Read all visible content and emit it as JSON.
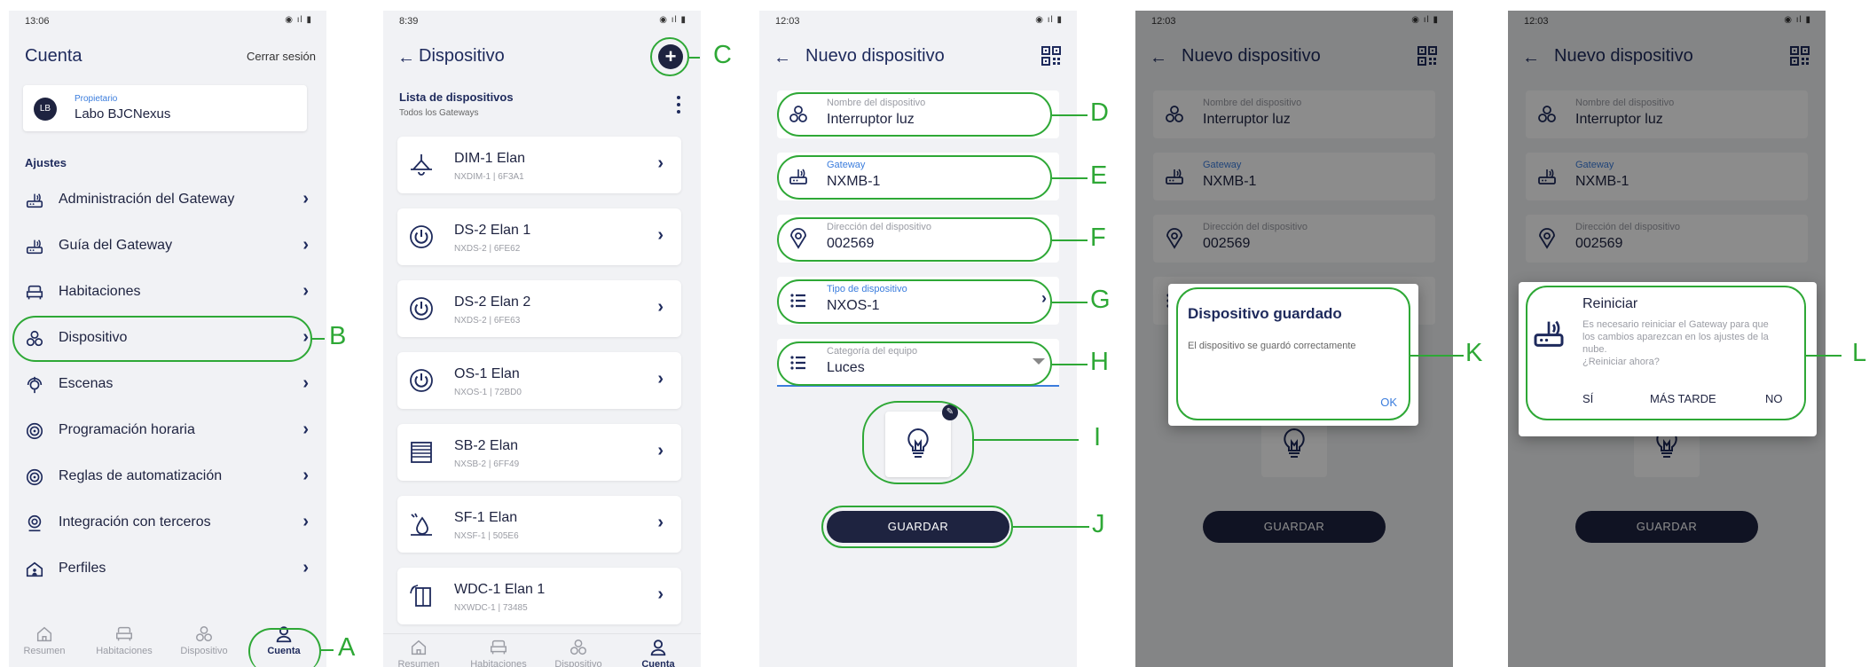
{
  "screen1": {
    "time": "13:06",
    "title": "Cuenta",
    "logout": "Cerrar sesión",
    "owner_initials": "LB",
    "owner_role": "Propietario",
    "owner_name": "Labo BJCNexus",
    "settings_label": "Ajustes",
    "menu": [
      {
        "label": "Administración del Gateway",
        "icon": "gateway-icon"
      },
      {
        "label": "Guía del Gateway",
        "icon": "gateway-icon"
      },
      {
        "label": "Habitaciones",
        "icon": "sofa-icon"
      },
      {
        "label": "Dispositivo",
        "icon": "device-icon"
      },
      {
        "label": "Escenas",
        "icon": "scene-icon"
      },
      {
        "label": "Programación horaria",
        "icon": "schedule-icon"
      },
      {
        "label": "Reglas de automatización",
        "icon": "automation-icon"
      },
      {
        "label": "Integración con terceros",
        "icon": "integration-icon"
      },
      {
        "label": "Perfiles",
        "icon": "house-icon"
      }
    ]
  },
  "screen2": {
    "time": "8:39",
    "title": "Dispositivo",
    "list_title": "Lista de dispositivos",
    "list_sub": "Todos los Gateways",
    "devices": [
      {
        "name": "DIM-1 Elan",
        "sub": "NXDIM-1  |  6F3A1",
        "icon": "lamp-icon"
      },
      {
        "name": "DS-2 Elan 1",
        "sub": "NXDS-2  |  6FE62",
        "icon": "power-icon"
      },
      {
        "name": "DS-2 Elan 2",
        "sub": "NXDS-2  |  6FE63",
        "icon": "power-icon"
      },
      {
        "name": "OS-1 Elan",
        "sub": "NXOS-1  |  72BD0",
        "icon": "power-icon"
      },
      {
        "name": "SB-2 Elan",
        "sub": "NXSB-2  |  6FF49",
        "icon": "blinds-icon"
      },
      {
        "name": "SF-1 Elan",
        "sub": "NXSF-1  |  505E6",
        "icon": "water-icon"
      },
      {
        "name": "WDC-1 Elan 1",
        "sub": "NXWDC-1  |  73485",
        "icon": "window-icon"
      }
    ]
  },
  "screen3": {
    "time": "12:03",
    "title": "Nuevo dispositivo",
    "fields": [
      {
        "label": "Nombre del dispositivo",
        "value": "Interruptor luz"
      },
      {
        "label": "Gateway",
        "value": "NXMB-1"
      },
      {
        "label": "Dirección del dispositivo",
        "value": "002569"
      },
      {
        "label": "Tipo de dispositivo",
        "value": "NXOS-1"
      },
      {
        "label": "Categoría del equipo",
        "value": "Luces"
      }
    ],
    "save": "GUARDAR"
  },
  "dialog_saved": {
    "title": "Dispositivo guardado",
    "body": "El dispositivo se guardó correctamente",
    "ok": "OK"
  },
  "dialog_restart": {
    "title": "Reiniciar",
    "body1": "Es necesario reiniciar el Gateway para que",
    "body2": "los cambios aparezcan en los ajustes de la",
    "body3": "nube.",
    "body4": "¿Reiniciar ahora?",
    "yes": "SÍ",
    "later": "MÁS TARDE",
    "no": "NO"
  },
  "nav": [
    "Resumen",
    "Habitaciones",
    "Dispositivo",
    "Cuenta"
  ],
  "callouts": [
    "A",
    "B",
    "C",
    "D",
    "E",
    "F",
    "G",
    "H",
    "I",
    "J",
    "K",
    "L"
  ],
  "colors": {
    "accent": "#2ea836",
    "navy": "#1e2a5c",
    "link": "#3b7ddd"
  }
}
